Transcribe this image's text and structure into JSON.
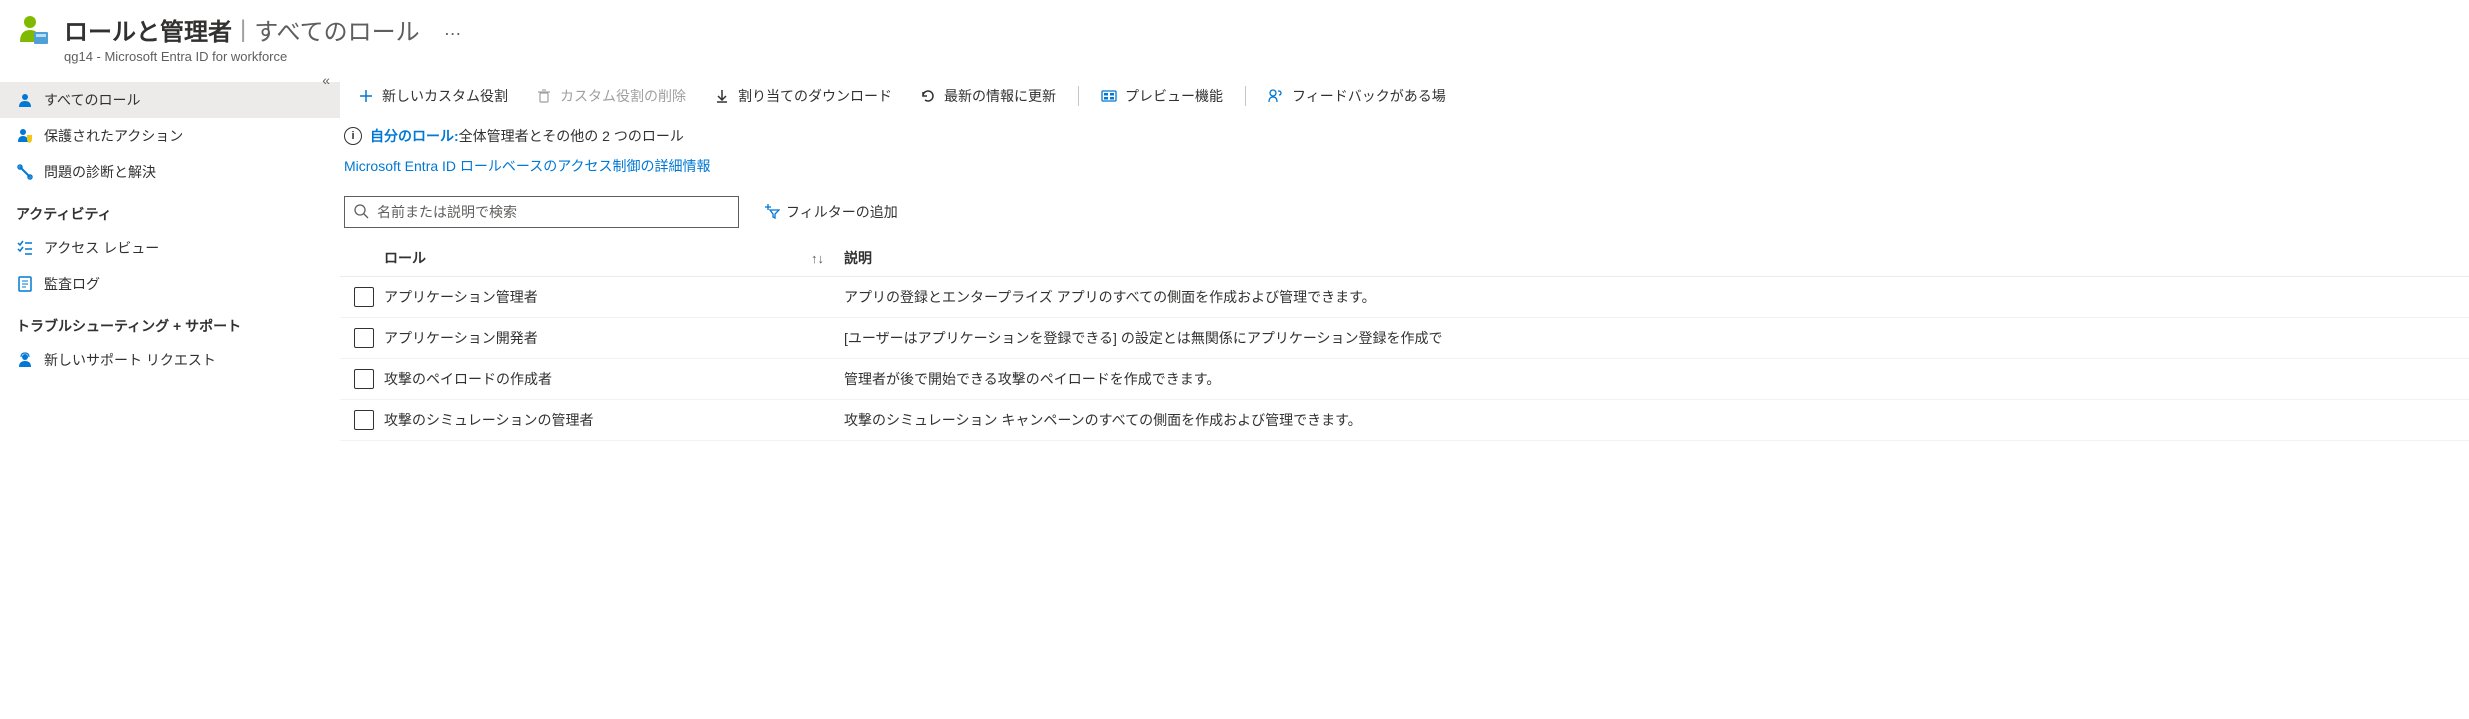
{
  "header": {
    "title": "ロールと管理者",
    "separator": "|",
    "subtitle_part": "すべてのロール",
    "more": "…",
    "tenant_line": "qg14 - Microsoft Entra ID for workforce"
  },
  "sidebar": {
    "collapse_glyph": "«",
    "items": [
      {
        "id": "all-roles",
        "label": "すべてのロール",
        "icon": "person-icon",
        "active": true
      },
      {
        "id": "protected-actions",
        "label": "保護されたアクション",
        "icon": "person-shield-icon",
        "active": false
      },
      {
        "id": "diagnose",
        "label": "問題の診断と解決",
        "icon": "wrench-icon",
        "active": false
      }
    ],
    "section_activity": "アクティビティ",
    "activity_items": [
      {
        "id": "access-review",
        "label": "アクセス レビュー",
        "icon": "checklist-icon"
      },
      {
        "id": "audit-log",
        "label": "監査ログ",
        "icon": "log-icon"
      }
    ],
    "section_troubleshoot": "トラブルシューティング + サポート",
    "troubleshoot_items": [
      {
        "id": "new-support",
        "label": "新しいサポート リクエスト",
        "icon": "support-person-icon"
      }
    ]
  },
  "toolbar": {
    "new_custom_role": "新しいカスタム役割",
    "delete_custom_role": "カスタム役割の削除",
    "download_assignments": "割り当てのダウンロード",
    "refresh": "最新の情報に更新",
    "preview_features": "プレビュー機能",
    "feedback": "フィードバックがある場"
  },
  "info": {
    "your_role_label": "自分のロール:",
    "your_role_text": "全体管理者とその他の 2 つのロール",
    "doc_link": "Microsoft Entra ID ロールベースのアクセス制御の詳細情報"
  },
  "filters": {
    "search_placeholder": "名前または説明で検索",
    "add_filter": "フィルターの追加"
  },
  "table": {
    "col_role": "ロール",
    "sort_glyph": "↑↓",
    "col_desc": "説明",
    "rows": [
      {
        "role": "アプリケーション管理者",
        "desc": "アプリの登録とエンタープライズ アプリのすべての側面を作成および管理できます。"
      },
      {
        "role": "アプリケーション開発者",
        "desc": "[ユーザーはアプリケーションを登録できる] の設定とは無関係にアプリケーション登録を作成で"
      },
      {
        "role": "攻撃のペイロードの作成者",
        "desc": "管理者が後で開始できる攻撃のペイロードを作成できます。"
      },
      {
        "role": "攻撃のシミュレーションの管理者",
        "desc": "攻撃のシミュレーション キャンペーンのすべての側面を作成および管理できます。"
      }
    ]
  }
}
